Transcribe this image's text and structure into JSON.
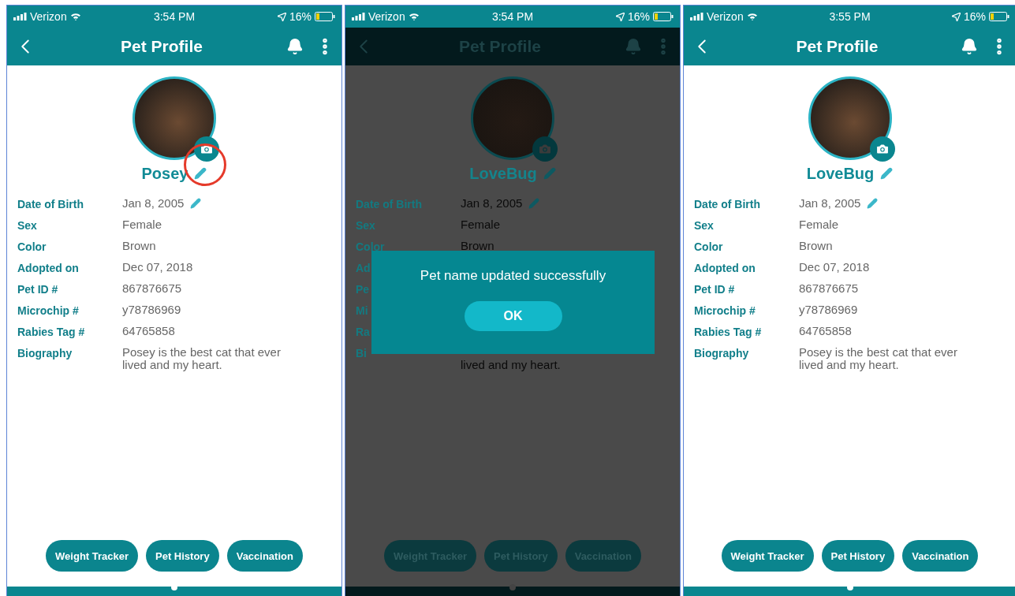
{
  "screens": [
    {
      "dimmed": false,
      "status": {
        "carrier": "Verizon",
        "time": "3:54 PM",
        "battery": "16%"
      },
      "header": {
        "title": "Pet Profile"
      },
      "pet_name": "Posey",
      "name_edit_circled": true,
      "fields": [
        {
          "label": "Date of Birth",
          "value": "Jan 8, 2005",
          "editable": true
        },
        {
          "label": "Sex",
          "value": "Female",
          "editable": false
        },
        {
          "label": "Color",
          "value": "Brown",
          "editable": false
        },
        {
          "label": "Adopted on",
          "value": "Dec 07, 2018",
          "editable": false
        },
        {
          "label": "Pet ID #",
          "value": "867876675",
          "editable": false
        },
        {
          "label": "Microchip #",
          "value": "y78786969",
          "editable": false
        },
        {
          "label": "Rabies Tag #",
          "value": "64765858",
          "editable": false
        },
        {
          "label": "Biography",
          "value": "Posey is the best cat that ever lived and my heart.",
          "editable": false
        }
      ],
      "buttons": [
        "Weight Tracker",
        "Pet History",
        "Vaccination"
      ]
    },
    {
      "dimmed": true,
      "status": {
        "carrier": "Verizon",
        "time": "3:54 PM",
        "battery": "16%"
      },
      "header": {
        "title": "Pet Profile"
      },
      "pet_name": "LoveBug",
      "name_edit_circled": false,
      "fields": [
        {
          "label": "Date of Birth",
          "value": "Jan 8, 2005",
          "editable": true
        },
        {
          "label": "Sex",
          "value": "Female",
          "editable": false
        },
        {
          "label": "Color",
          "value": "Brown",
          "editable": false
        },
        {
          "label": "Ad",
          "editable": false
        },
        {
          "label": "Pe",
          "editable": false
        },
        {
          "label": "Mi",
          "editable": false
        },
        {
          "label": "Ra",
          "editable": false
        },
        {
          "label": "Bi",
          "value": "lived and my heart.",
          "kind": "continued",
          "editable": false
        }
      ],
      "buttons": [
        "Weight Tracker",
        "Pet History",
        "Vaccination"
      ],
      "dialog": {
        "message": "Pet name updated successfully",
        "button": "OK"
      }
    },
    {
      "dimmed": false,
      "status": {
        "carrier": "Verizon",
        "time": "3:55 PM",
        "battery": "16%"
      },
      "header": {
        "title": "Pet Profile"
      },
      "pet_name": "LoveBug",
      "name_edit_circled": false,
      "fields": [
        {
          "label": "Date of Birth",
          "value": "Jan 8, 2005",
          "editable": true
        },
        {
          "label": "Sex",
          "value": "Female",
          "editable": false
        },
        {
          "label": "Color",
          "value": "Brown",
          "editable": false
        },
        {
          "label": "Adopted on",
          "value": "Dec 07, 2018",
          "editable": false
        },
        {
          "label": "Pet ID #",
          "value": "867876675",
          "editable": false
        },
        {
          "label": "Microchip #",
          "value": "y78786969",
          "editable": false
        },
        {
          "label": "Rabies Tag #",
          "value": "64765858",
          "editable": false
        },
        {
          "label": "Biography",
          "value": "Posey is the best cat that ever lived and my heart.",
          "editable": false
        }
      ],
      "buttons": [
        "Weight Tracker",
        "Pet History",
        "Vaccination"
      ]
    }
  ]
}
